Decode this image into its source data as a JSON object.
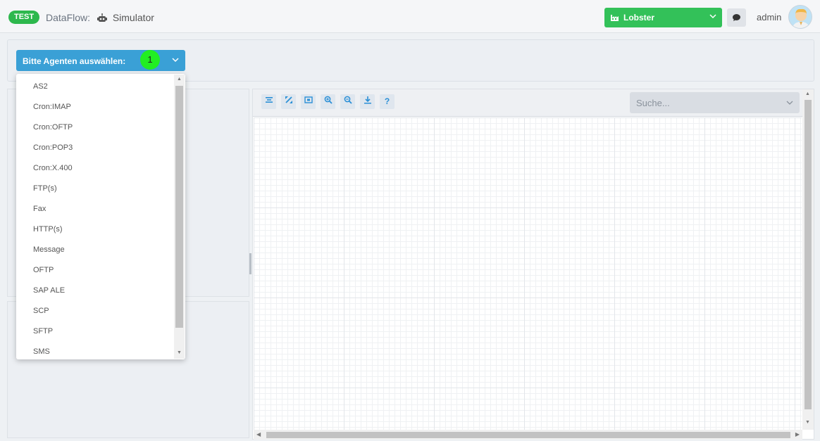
{
  "header": {
    "badge": "TEST",
    "app": "DataFlow:",
    "page": "Simulator",
    "tenant": "Lobster",
    "user": "admin"
  },
  "agent_select": {
    "label": "Bitte Agenten auswählen:",
    "marker": "1",
    "options": [
      "AS2",
      "Cron:IMAP",
      "Cron:OFTP",
      "Cron:POP3",
      "Cron:X.400",
      "FTP(s)",
      "Fax",
      "HTTP(s)",
      "Message",
      "OFTP",
      "SAP ALE",
      "SCP",
      "SFTP",
      "SMS"
    ]
  },
  "toolbar": {
    "buttons": [
      "align-icon",
      "fullscreen-icon",
      "fit-icon",
      "zoom-in-icon",
      "zoom-out-icon",
      "download-icon",
      "help-icon"
    ],
    "help_label": "?"
  },
  "search": {
    "placeholder": "Suche..."
  },
  "colors": {
    "accent": "#3aa0d6",
    "green": "#33c159",
    "badge": "#2db84d"
  }
}
